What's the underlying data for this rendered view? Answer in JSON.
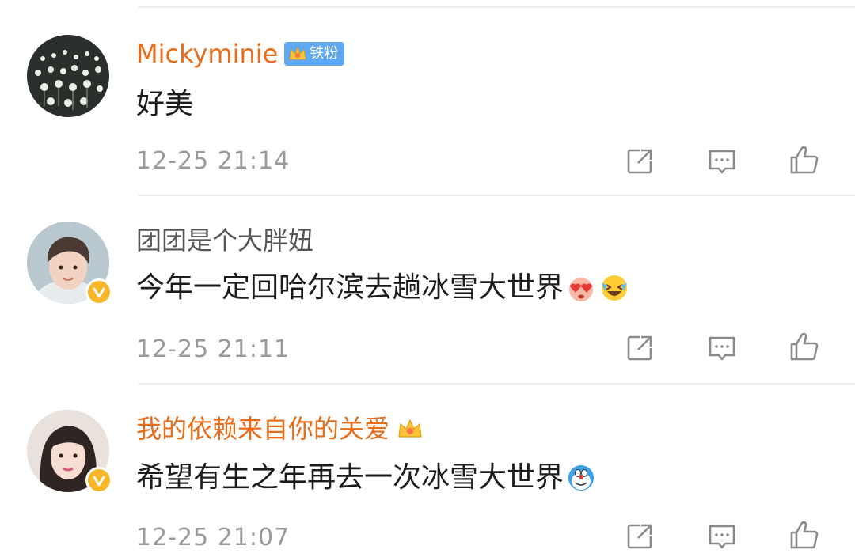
{
  "comments": [
    {
      "username": "Mickyminie",
      "fan_badge": "铁粉",
      "text": "好美",
      "time": "12-25 21:14",
      "verified": false,
      "emojis": []
    },
    {
      "username": "团团是个大胖妞",
      "text": "今年一定回哈尔滨去趟冰雪大世界",
      "time": "12-25 21:11",
      "verified": true,
      "emojis": [
        "heart-eyes-emoji",
        "crying-laughing-emoji"
      ]
    },
    {
      "username": "我的依赖来自你的关爱",
      "text": "希望有生之年再去一次冰雪大世界",
      "time": "12-25 21:07",
      "verified": true,
      "emojis": [
        "doraemon-emoji"
      ]
    }
  ],
  "colors": {
    "vip_name": "#e86c1a",
    "normal_name": "#555555",
    "fan_badge": "#5fa8f5",
    "verified": "#f8b628",
    "timestamp": "#9a9a9a",
    "icon": "#8a8a8a"
  },
  "icons": [
    "share-icon",
    "reply-icon",
    "like-icon",
    "crown-icon",
    "verified-icon"
  ]
}
